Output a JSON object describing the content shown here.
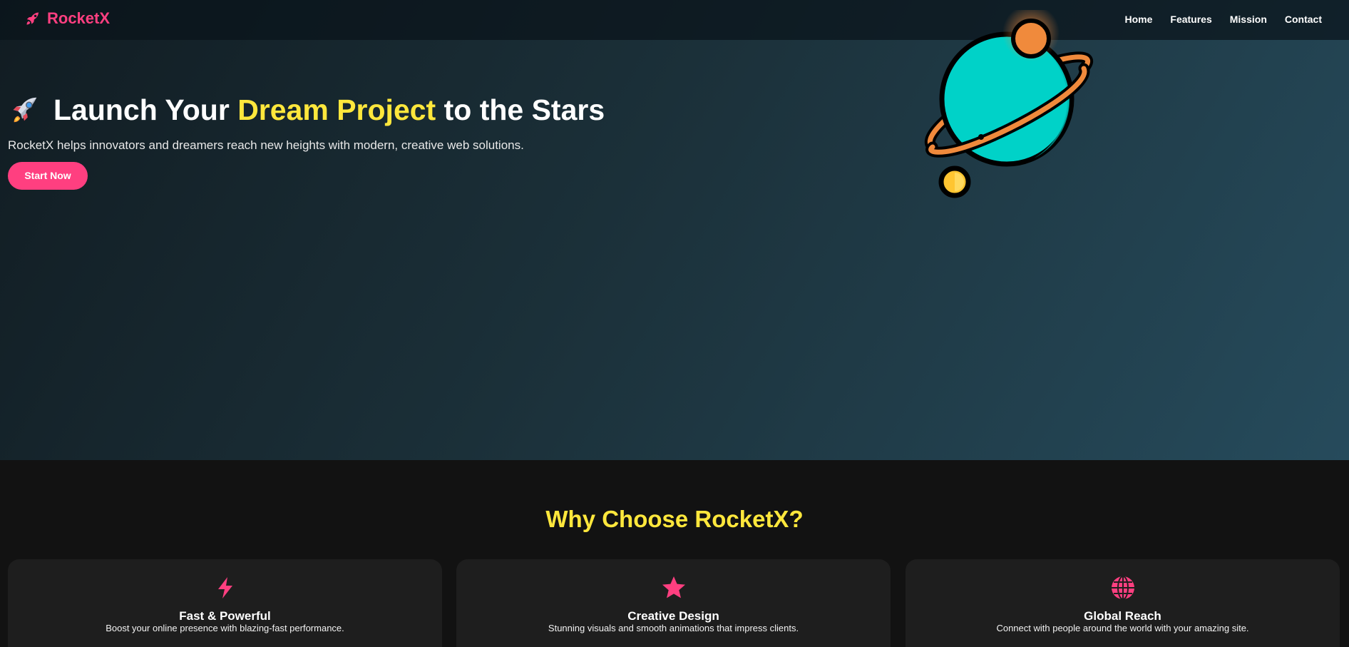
{
  "nav": {
    "brand": "RocketX",
    "links": [
      "Home",
      "Features",
      "Mission",
      "Contact"
    ]
  },
  "hero": {
    "title_before": "Launch Your",
    "title_accent": "Dream Project",
    "title_after": "to the Stars",
    "subtitle": "RocketX helps innovators and dreamers reach new heights with modern, creative web solutions.",
    "cta_label": "Start Now"
  },
  "features": {
    "heading": "Why Choose RocketX?",
    "cards": [
      {
        "icon": "bolt-icon",
        "title": "Fast & Powerful",
        "text": "Boost your online presence with blazing-fast performance."
      },
      {
        "icon": "star-icon",
        "title": "Creative Design",
        "text": "Stunning visuals and smooth animations that impress clients."
      },
      {
        "icon": "globe-icon",
        "title": "Global Reach",
        "text": "Connect with people around the world with your amazing site."
      }
    ]
  },
  "colors": {
    "brand_pink": "#ff3f80",
    "accent_yellow": "#ffe73c",
    "planet_teal": "#00d2c8",
    "ring_orange": "#f08a3c"
  }
}
